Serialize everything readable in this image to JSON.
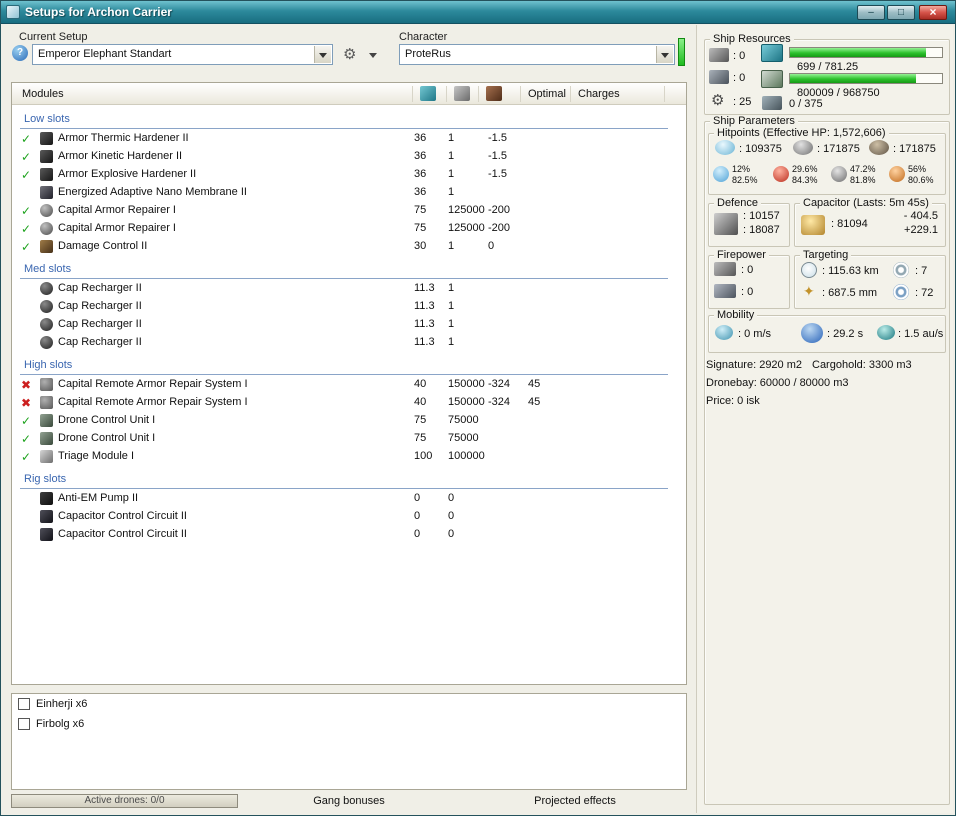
{
  "window": {
    "title": "Setups for Archon Carrier"
  },
  "setup": {
    "label": "Current Setup",
    "value": "Emperor Elephant Standart"
  },
  "character": {
    "label": "Character",
    "value": "ProteRus"
  },
  "icons": {
    "ok": "✓",
    "error": "✖"
  },
  "modules": {
    "header": {
      "name": "Modules",
      "optimal": "Optimal",
      "charges": "Charges"
    },
    "sections": [
      {
        "title": "Low slots",
        "rows": [
          {
            "status": "ok",
            "icon": "armor-hardener-icon",
            "name": "Armor Thermic Hardener II",
            "cpu": "36",
            "pg": "1",
            "cap": "-1.5",
            "optimal": "",
            "charges": ""
          },
          {
            "status": "ok",
            "icon": "armor-hardener-icon",
            "name": "Armor Kinetic Hardener II",
            "cpu": "36",
            "pg": "1",
            "cap": "-1.5",
            "optimal": "",
            "charges": ""
          },
          {
            "status": "ok",
            "icon": "armor-hardener-icon",
            "name": "Armor Explosive Hardener II",
            "cpu": "36",
            "pg": "1",
            "cap": "-1.5",
            "optimal": "",
            "charges": ""
          },
          {
            "status": "none",
            "icon": "membrane-icon",
            "name": "Energized Adaptive Nano Membrane II",
            "cpu": "36",
            "pg": "1",
            "cap": "",
            "optimal": "",
            "charges": ""
          },
          {
            "status": "ok",
            "icon": "armor-repairer-icon",
            "name": "Capital Armor Repairer I",
            "cpu": "75",
            "pg": "125000",
            "cap": "-200",
            "optimal": "",
            "charges": ""
          },
          {
            "status": "ok",
            "icon": "armor-repairer-icon",
            "name": "Capital Armor Repairer I",
            "cpu": "75",
            "pg": "125000",
            "cap": "-200",
            "optimal": "",
            "charges": ""
          },
          {
            "status": "ok",
            "icon": "damage-control-icon",
            "name": "Damage Control II",
            "cpu": "30",
            "pg": "1",
            "cap": "0",
            "optimal": "",
            "charges": ""
          }
        ]
      },
      {
        "title": "Med slots",
        "rows": [
          {
            "status": "none",
            "icon": "cap-recharger-icon",
            "name": "Cap Recharger II",
            "cpu": "11.3",
            "pg": "1",
            "cap": "",
            "optimal": "",
            "charges": ""
          },
          {
            "status": "none",
            "icon": "cap-recharger-icon",
            "name": "Cap Recharger II",
            "cpu": "11.3",
            "pg": "1",
            "cap": "",
            "optimal": "",
            "charges": ""
          },
          {
            "status": "none",
            "icon": "cap-recharger-icon",
            "name": "Cap Recharger II",
            "cpu": "11.3",
            "pg": "1",
            "cap": "",
            "optimal": "",
            "charges": ""
          },
          {
            "status": "none",
            "icon": "cap-recharger-icon",
            "name": "Cap Recharger II",
            "cpu": "11.3",
            "pg": "1",
            "cap": "",
            "optimal": "",
            "charges": ""
          }
        ]
      },
      {
        "title": "High slots",
        "rows": [
          {
            "status": "error",
            "icon": "remote-repair-icon",
            "name": "Capital Remote Armor Repair System I",
            "cpu": "40",
            "pg": "150000",
            "cap": "-324",
            "optimal": "45",
            "charges": ""
          },
          {
            "status": "error",
            "icon": "remote-repair-icon",
            "name": "Capital Remote Armor Repair System I",
            "cpu": "40",
            "pg": "150000",
            "cap": "-324",
            "optimal": "45",
            "charges": ""
          },
          {
            "status": "ok",
            "icon": "drone-control-icon",
            "name": "Drone Control Unit I",
            "cpu": "75",
            "pg": "75000",
            "cap": "",
            "optimal": "",
            "charges": ""
          },
          {
            "status": "ok",
            "icon": "drone-control-icon",
            "name": "Drone Control Unit I",
            "cpu": "75",
            "pg": "75000",
            "cap": "",
            "optimal": "",
            "charges": ""
          },
          {
            "status": "ok",
            "icon": "triage-icon",
            "name": "Triage Module I",
            "cpu": "100",
            "pg": "100000",
            "cap": "",
            "optimal": "",
            "charges": ""
          }
        ]
      },
      {
        "title": "Rig slots",
        "rows": [
          {
            "status": "none",
            "icon": "anti-em-pump-icon",
            "name": "Anti-EM Pump II",
            "cpu": "0",
            "pg": "0",
            "cap": "",
            "optimal": "",
            "charges": ""
          },
          {
            "status": "none",
            "icon": "cap-circuit-icon",
            "name": "Capacitor Control Circuit II",
            "cpu": "0",
            "pg": "0",
            "cap": "",
            "optimal": "",
            "charges": ""
          },
          {
            "status": "none",
            "icon": "cap-circuit-icon",
            "name": "Capacitor Control Circuit II",
            "cpu": "0",
            "pg": "0",
            "cap": "",
            "optimal": "",
            "charges": ""
          }
        ]
      }
    ]
  },
  "drones": {
    "items": [
      {
        "label": "Einherji x6"
      },
      {
        "label": "Firbolg x6"
      }
    ]
  },
  "bottom": {
    "active_drones": "Active drones: 0/0",
    "gang_bonuses": "Gang bonuses",
    "projected_effects": "Projected effects"
  },
  "resources": {
    "title": "Ship Resources",
    "turrets": ": 0",
    "launchers": ": 0",
    "calibration": ": 25",
    "cpu": "699 / 781.25",
    "powergrid": "800009 / 968750",
    "drone_bandwidth": "0 / 375"
  },
  "parameters": {
    "title": "Ship Parameters",
    "hitpoints": {
      "title": "Hitpoints (Effective HP: 1,572,606)",
      "shield": ": 109375",
      "armor": ": 171875",
      "structure": ": 171875",
      "resists": [
        {
          "a": "12%",
          "b": "82.5%"
        },
        {
          "a": "29.6%",
          "b": "84.3%"
        },
        {
          "a": "47.2%",
          "b": "81.8%"
        },
        {
          "a": "56%",
          "b": "80.6%"
        }
      ]
    },
    "defence": {
      "title": "Defence",
      "line1": ": 10157",
      "line2": ": 18087"
    },
    "capacitor": {
      "title": "Capacitor (Lasts: 5m 45s)",
      "amount": ": 81094",
      "drain": "- 404.5",
      "recharge": "+229.1"
    },
    "firepower": {
      "title": "Firepower",
      "turret": ": 0",
      "missile": ": 0"
    },
    "targeting": {
      "title": "Targeting",
      "range": ": 115.63 km",
      "max_targets": ": 7",
      "scan_res": ": 687.5 mm",
      "sensor": ": 72"
    },
    "mobility": {
      "title": "Mobility",
      "speed": ": 0 m/s",
      "align": ": 29.2 s",
      "warp": ": 1.5 au/s"
    },
    "signature": "Signature: 2920 m2",
    "cargohold": "Cargohold: 3300 m3",
    "dronebay": "Dronebay: 60000 / 80000 m3",
    "price": "Price: 0 isk"
  }
}
